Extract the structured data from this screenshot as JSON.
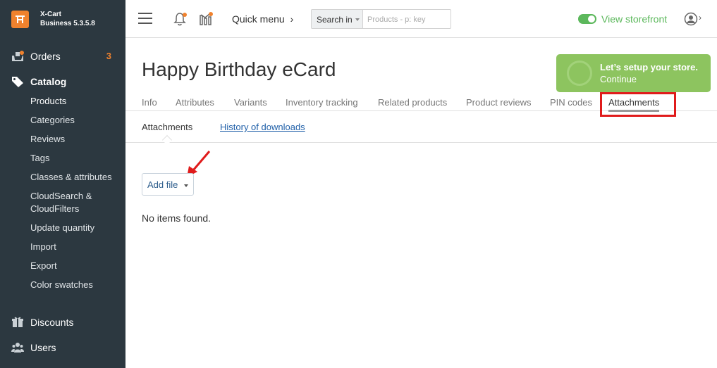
{
  "brand": {
    "name_line1": "X-Cart",
    "name_line2": "Business 5.3.5.8",
    "accent": "#f0822e"
  },
  "sidebar": {
    "orders": {
      "label": "Orders",
      "count": "3"
    },
    "catalog": {
      "label": "Catalog",
      "items": [
        {
          "label": "Products"
        },
        {
          "label": "Categories"
        },
        {
          "label": "Reviews"
        },
        {
          "label": "Tags"
        },
        {
          "label": "Classes & attributes"
        },
        {
          "label": "CloudSearch &"
        },
        {
          "label": "CloudFilters"
        },
        {
          "label": "Update quantity"
        },
        {
          "label": "Import"
        },
        {
          "label": "Export"
        },
        {
          "label": "Color swatches"
        }
      ]
    },
    "discounts": {
      "label": "Discounts"
    },
    "users": {
      "label": "Users"
    }
  },
  "topbar": {
    "quick_menu": "Quick menu",
    "search": {
      "select_label": "Search in",
      "placeholder": "Products - p: key"
    },
    "storefront_label": "View storefront"
  },
  "page": {
    "title": "Happy Birthday eCard"
  },
  "setup": {
    "title": "Let’s setup your store.",
    "link": "Continue"
  },
  "tabs": [
    {
      "label": "Info"
    },
    {
      "label": "Attributes"
    },
    {
      "label": "Variants"
    },
    {
      "label": "Inventory tracking"
    },
    {
      "label": "Related products"
    },
    {
      "label": "Product reviews"
    },
    {
      "label": "PIN codes"
    },
    {
      "label": "Attachments"
    }
  ],
  "subtabs": [
    {
      "label": "Attachments"
    },
    {
      "label": "History of downloads"
    }
  ],
  "content": {
    "add_file_label": "Add file",
    "empty_text": "No items found."
  },
  "colors": {
    "sidebar_bg": "#2c3840",
    "accent_green": "#5cb85c",
    "highlight_red": "#e01b1b"
  }
}
